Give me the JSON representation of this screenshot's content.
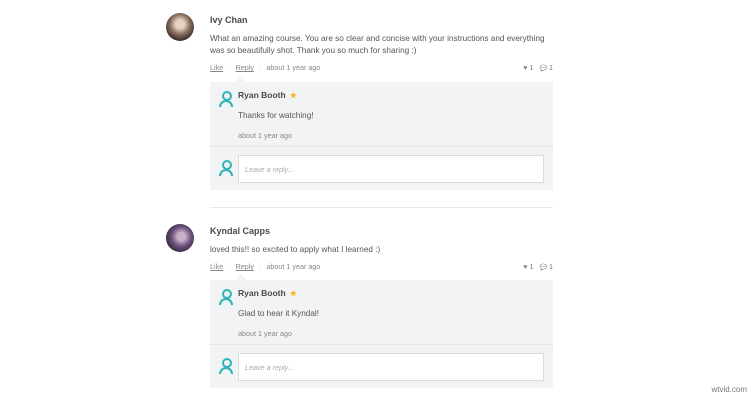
{
  "comments": [
    {
      "author": "Ivy Chan",
      "text": "What an amazing course. You are so clear and concise with your instructions and everything was so beautifully shot. Thank you so much for sharing :)",
      "like_label": "Like",
      "reply_label": "Reply",
      "time": "about 1 year ago",
      "likes": "1",
      "replies_count": "1",
      "reply": {
        "author": "Ryan Booth",
        "text": "Thanks for watching!",
        "time": "about 1 year ago"
      },
      "reply_placeholder": "Leave a reply..."
    },
    {
      "author": "Kyndal Capps",
      "text": "loved this!! so excited to apply what I learned :)",
      "like_label": "Like",
      "reply_label": "Reply",
      "time": "about 1 year ago",
      "likes": "1",
      "replies_count": "1",
      "reply": {
        "author": "Ryan Booth",
        "text": "Glad to hear it Kyndal!",
        "time": "about 1 year ago"
      },
      "reply_placeholder": "Leave a reply..."
    }
  ],
  "symbols": {
    "dot": "·",
    "star": "★",
    "heart": "♥",
    "bubble": "💬"
  },
  "watermark": "wtvid.com",
  "colors": {
    "accent": "#2fb3b5",
    "star": "#f5b72a",
    "reply_bg": "#f2f3f4"
  }
}
